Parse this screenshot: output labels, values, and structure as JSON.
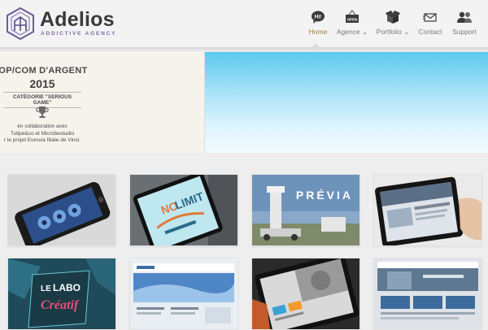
{
  "header": {
    "brand": "Adelios",
    "tagline": "ADDICTIVE AGENCY"
  },
  "nav": [
    {
      "label": "Home",
      "icon": "hi-bubble-icon",
      "active": true
    },
    {
      "label": "Agence ⌄",
      "icon": "open-sign-icon",
      "active": false
    },
    {
      "label": "Portfolio ⌄",
      "icon": "box-icon",
      "active": false
    },
    {
      "label": "Contact",
      "icon": "mail-icon",
      "active": false
    },
    {
      "label": "Support",
      "icon": "people-icon",
      "active": false
    }
  ],
  "nav_icon_texts": {
    "home": "Hi!",
    "agence": "OPEN"
  },
  "banner": {
    "title": "OP/COM D'ARGENT",
    "year": "2015",
    "category": "CATÉGORIE \"SERIOUS GAME\"",
    "collab_line1": "en collaboration avec",
    "collab_line2": "Tulipe&co et Microbestudio",
    "collab_line3": "r le projet Eurovia filiale de Vinci."
  },
  "portfolio": [
    {
      "name": "phone-app"
    },
    {
      "name": "no-limit-poster",
      "text1": "NO",
      "text2": "LIMIT"
    },
    {
      "name": "previa",
      "caption": "PRÉVIA"
    },
    {
      "name": "tablet-site"
    },
    {
      "name": "labo-creatif",
      "text1": "LE",
      "text2": "LABO",
      "text3": "Créatif"
    },
    {
      "name": "website-sky"
    },
    {
      "name": "tablet-photo"
    },
    {
      "name": "website-bank"
    }
  ],
  "colors": {
    "accent": "#a07d3a",
    "brand_purple": "#7d6aa6",
    "sky": "#5cc9ee"
  }
}
